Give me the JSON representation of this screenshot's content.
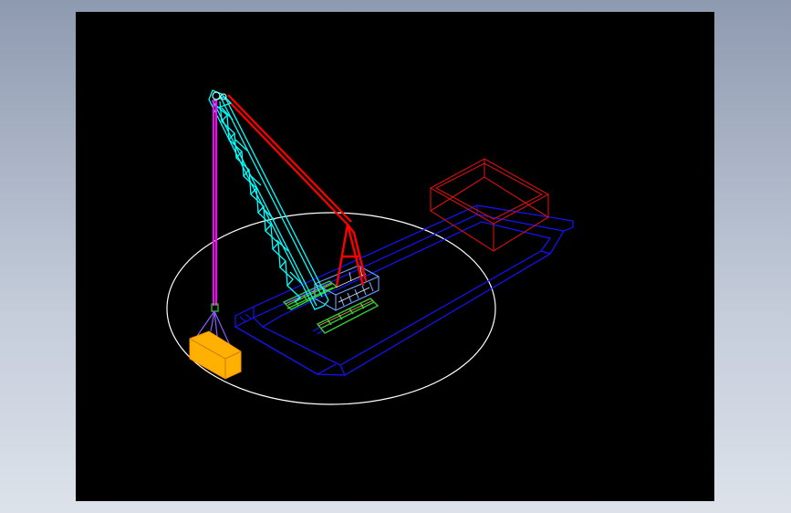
{
  "scene": {
    "subject": "crane-barge-isometric-wireframe",
    "colors": {
      "window_background": "#b4bccb",
      "viewport_background": "#000000",
      "boom": "#00ffff",
      "pendant_lines": "#ff0000",
      "hoist_line": "#ff00ff",
      "barge_hull": "#1414ff",
      "cargo_box": "#d81010",
      "swing_circle": "#ffffff",
      "load_block": "#ffb000",
      "crawler_tracks": "#33cc33",
      "rigging": "#8844ff"
    }
  }
}
